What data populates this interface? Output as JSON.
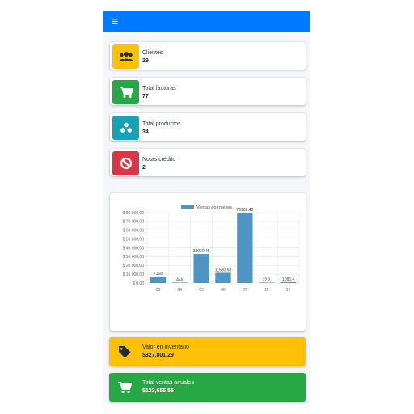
{
  "colors": {
    "topbar": "#007bff",
    "background": "#f4f6f9",
    "warning": "#ffc107",
    "success": "#28a745",
    "info": "#17a2b8",
    "danger": "#dc3545",
    "bar": "#4e95c4"
  },
  "header": {
    "menu_icon": "menu-icon"
  },
  "info_boxes": [
    {
      "label": "Clientes",
      "value": "29",
      "icon": "users-icon"
    },
    {
      "label": "Total facturas",
      "value": "77",
      "icon": "cart-icon"
    },
    {
      "label": "Total productos",
      "value": "34",
      "icon": "cubes-icon"
    },
    {
      "label": "Notas crédito",
      "value": "2",
      "icon": "ban-icon"
    }
  ],
  "chart_data": {
    "type": "bar",
    "title": "",
    "xlabel": "",
    "ylabel": "",
    "legend": "Ventas por meses",
    "legend_position": "top",
    "grid": true,
    "categories": [
      "03",
      "04",
      "05",
      "06",
      "07",
      "11",
      "12"
    ],
    "values": [
      7168,
      446,
      33030.45,
      11530.68,
      79962.43,
      22.3,
      1086.4
    ],
    "value_labels": [
      "7168",
      "446",
      "33030.45",
      "11530.68",
      "79962.43",
      "22.3",
      "1086.4"
    ],
    "ylim": [
      0,
      80000
    ],
    "y_ticks": [
      0,
      10000,
      20000,
      30000,
      40000,
      50000,
      60000,
      70000,
      80000
    ],
    "y_tick_labels": [
      "$ 0,00",
      "$ 10.000,00",
      "$ 20.000,00",
      "$ 30.000,00",
      "$ 40.000,00",
      "$ 50.000,00",
      "$ 60.000,00",
      "$ 70.000,00",
      "$ 80.000,00"
    ]
  },
  "summary": {
    "inventory": {
      "label": "Valor en inventario",
      "value": "$327,801.29",
      "icon": "tag-icon"
    },
    "annual_sales": {
      "label": "Total ventas anuales",
      "value": "$133,655.55",
      "icon": "cart-icon"
    }
  }
}
